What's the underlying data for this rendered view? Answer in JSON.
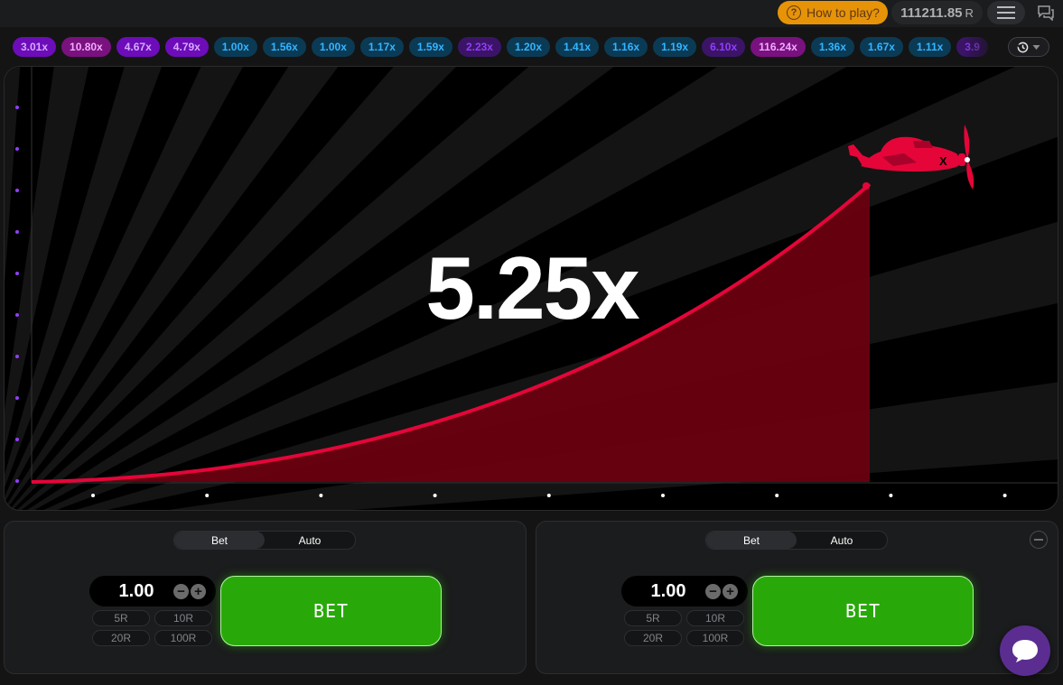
{
  "header": {
    "how_to_play": "How to play?",
    "balance": "111211.85",
    "currency": "R"
  },
  "history": [
    {
      "value": "3.01x",
      "color": "purple"
    },
    {
      "value": "10.80x",
      "color": "magenta"
    },
    {
      "value": "4.67x",
      "color": "purple"
    },
    {
      "value": "4.79x",
      "color": "purple"
    },
    {
      "value": "1.00x",
      "color": "blue"
    },
    {
      "value": "1.56x",
      "color": "blue"
    },
    {
      "value": "1.00x",
      "color": "blue"
    },
    {
      "value": "1.17x",
      "color": "blue"
    },
    {
      "value": "1.59x",
      "color": "blue"
    },
    {
      "value": "2.23x",
      "color": "purple2"
    },
    {
      "value": "1.20x",
      "color": "blue"
    },
    {
      "value": "1.41x",
      "color": "blue"
    },
    {
      "value": "1.16x",
      "color": "blue"
    },
    {
      "value": "1.19x",
      "color": "blue"
    },
    {
      "value": "6.10x",
      "color": "purple2"
    },
    {
      "value": "116.24x",
      "color": "magenta"
    },
    {
      "value": "1.36x",
      "color": "blue"
    },
    {
      "value": "1.67x",
      "color": "blue"
    },
    {
      "value": "1.11x",
      "color": "blue"
    },
    {
      "value": "3.9",
      "color": "purple2"
    }
  ],
  "game": {
    "multiplier": "5.25x",
    "colors": {
      "curve": "#e50539",
      "fill": "#6e0010",
      "plane": "#e50539",
      "axis_dot_left": "#913ef8",
      "axis_dot_bottom": "#ffffff"
    }
  },
  "panels": [
    {
      "tabs": [
        "Bet",
        "Auto"
      ],
      "active_tab": "Bet",
      "stake": "1.00",
      "minus": "−",
      "plus": "+",
      "quick_bets": [
        "5R",
        "10R",
        "20R",
        "100R"
      ],
      "bet_label": "BET"
    },
    {
      "tabs": [
        "Bet",
        "Auto"
      ],
      "active_tab": "Bet",
      "stake": "1.00",
      "minus": "−",
      "plus": "+",
      "quick_bets": [
        "5R",
        "10R",
        "20R",
        "100R"
      ],
      "bet_label": "BET"
    }
  ]
}
